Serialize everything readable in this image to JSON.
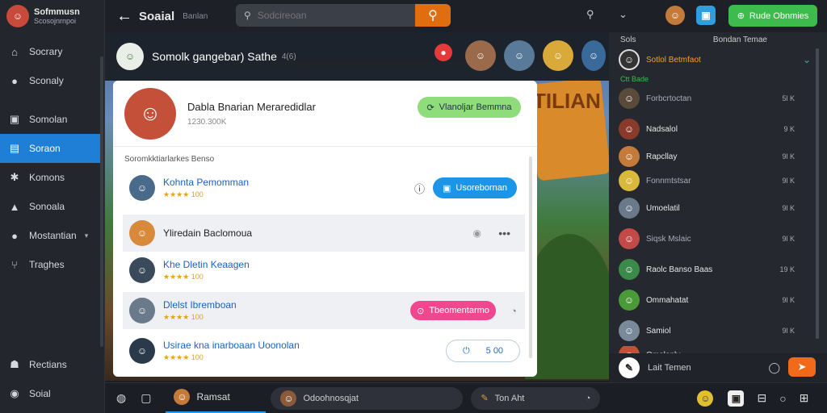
{
  "sidebar": {
    "profile": {
      "name": "Sofmmusn",
      "sub": "Scosojnrnpoi"
    },
    "items": [
      {
        "label": "Socrary",
        "icon": "home-icon",
        "glyph": "⌂"
      },
      {
        "label": "Sconaly",
        "icon": "location-icon",
        "glyph": "●"
      },
      {
        "label": "Somolan",
        "icon": "square-icon",
        "glyph": "▣"
      },
      {
        "label": "Soraon",
        "icon": "chat-icon",
        "glyph": "▤"
      },
      {
        "label": "Komons",
        "icon": "gear-icon",
        "glyph": "✱"
      },
      {
        "label": "Sonoala",
        "icon": "person-icon",
        "glyph": "▲"
      },
      {
        "label": "Mostantian",
        "icon": "pin-icon",
        "glyph": "●"
      },
      {
        "label": "Traghes",
        "icon": "branch-icon",
        "glyph": "⑂"
      }
    ],
    "bottom": [
      {
        "label": "Rectians",
        "icon": "group-icon",
        "glyph": "☗"
      },
      {
        "label": "Soial",
        "icon": "globe-icon",
        "glyph": "◉"
      }
    ]
  },
  "topbar": {
    "title": "Soaial",
    "subtitle": "Banlan",
    "search_placeholder": "Sodcireoan"
  },
  "right_top": {
    "button_label": "Rude Obnmies"
  },
  "game": {
    "strip_title": "Somolk gangebar) Sathe",
    "strip_count": "4(6)",
    "banner_text": "TILIAN"
  },
  "card": {
    "name": "Dabla Bnarian Meraredidlar",
    "meta": "1230.300K",
    "primary_button": "Vlanoljar Bemmna",
    "section_label": "Soromkktiarlarkes Benso",
    "rows": [
      {
        "name": "Kohnta Pemomman",
        "stars": "★★★★ 100",
        "action": "Usorebornan"
      },
      {
        "name": "Yliredain Baclomoua",
        "stars": ""
      },
      {
        "name": "Khe Dletin Keaagen",
        "stars": "★★★★ 100"
      },
      {
        "name": "Dlelst Ibremboan",
        "stars": "★★★★ 100",
        "action": "Tbeomentarmo"
      },
      {
        "name": "Usirae kna inarboaan Uoonolan",
        "stars": "★★★★ 100",
        "action": "5 00"
      }
    ]
  },
  "right_panel": {
    "header_left": "Sols",
    "header_right": "Bondan Temae",
    "selected": "Sotlol Betmfaot",
    "group_label": "Ctt Bade",
    "friends": [
      {
        "name": "Forbcrtoctan",
        "value": "5l K"
      },
      {
        "name": "Nadsalol",
        "value": "9 K"
      },
      {
        "name": "Rapcllay",
        "value": "9l K"
      },
      {
        "name": "Fonnmtstsar",
        "value": "9l K"
      },
      {
        "name": "Umoelatil",
        "value": "9l K"
      },
      {
        "name": "Siqsk Mslaic",
        "value": "9l K"
      },
      {
        "name": "Raolc Banso Baas",
        "value": "19 K"
      },
      {
        "name": "Ommahatat",
        "value": "9l K"
      },
      {
        "name": "Samiol",
        "value": "9l K"
      },
      {
        "name": "Omolenly",
        "value": ""
      }
    ],
    "input_placeholder": "Lait Temen"
  },
  "bottom_bar": {
    "tab_active": "Ramsat",
    "tab_2": "Odoohnosqjat",
    "tab_3": "Ton Aht"
  }
}
